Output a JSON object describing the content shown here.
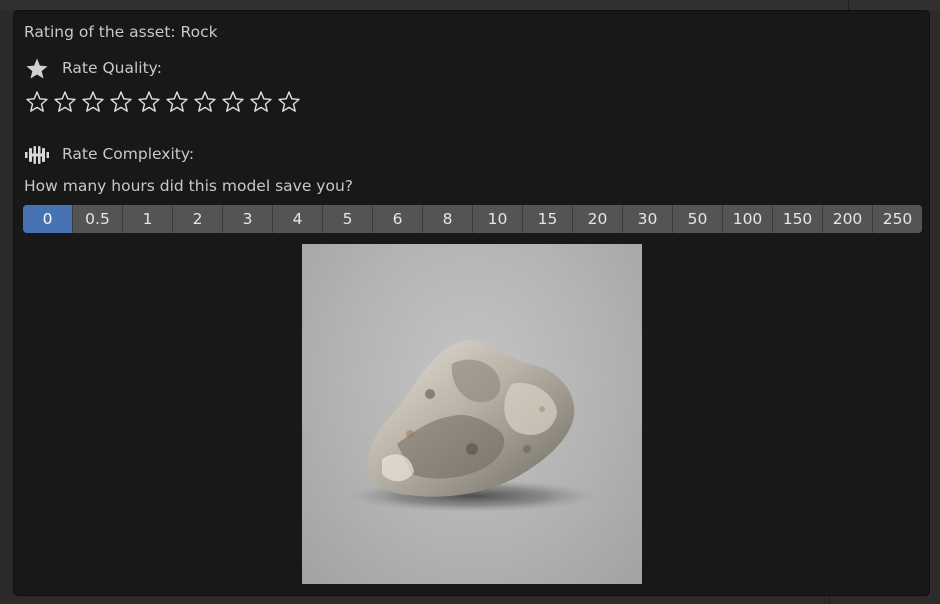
{
  "header": {
    "title": "Rating of the asset: Rock"
  },
  "quality": {
    "label": "Rate Quality:",
    "icon": "star-icon",
    "stars_total": 10,
    "stars_selected": 0
  },
  "complexity": {
    "label": "Rate Complexity:",
    "icon": "dumbbell-icon",
    "question": "How many hours did this model save you?",
    "options": [
      "0",
      "0.5",
      "1",
      "2",
      "3",
      "4",
      "5",
      "6",
      "8",
      "10",
      "15",
      "20",
      "30",
      "50",
      "100",
      "150",
      "200",
      "250"
    ],
    "selected": "0"
  },
  "preview": {
    "icon": "rock-thumbnail"
  },
  "colors": {
    "accent": "#4772b3",
    "panel": "#181818",
    "button": "#545454",
    "text": "#c8c8c8"
  }
}
